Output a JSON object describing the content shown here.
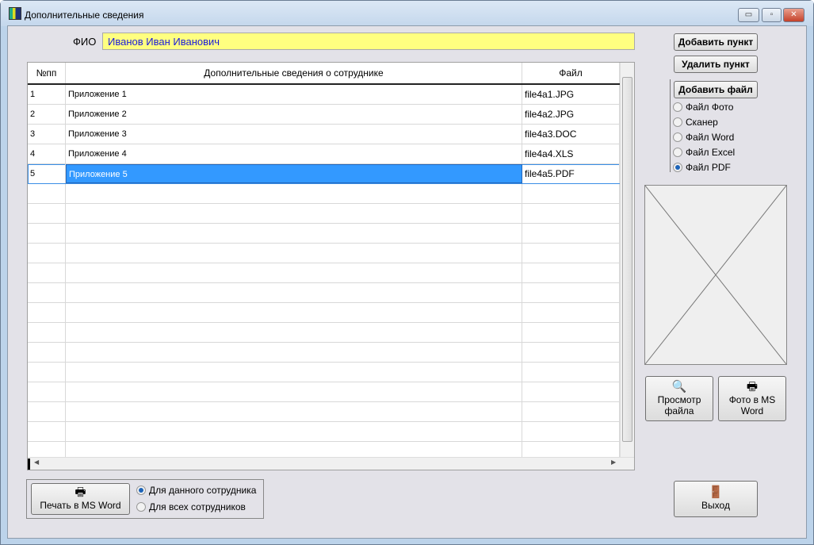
{
  "window": {
    "title": "Дополнительные сведения",
    "minimize": "▭",
    "maximize": "▫",
    "close": "✕"
  },
  "fio": {
    "label": "ФИО",
    "value": "Иванов Иван Иванович"
  },
  "grid": {
    "columns": [
      "№пп",
      "Дополнительные сведения о сотруднике",
      "Файл"
    ],
    "rows": [
      {
        "n": "1",
        "info": "Приложение 1",
        "file": "file4a1.JPG"
      },
      {
        "n": "2",
        "info": "Приложение 2",
        "file": "file4a2.JPG"
      },
      {
        "n": "3",
        "info": "Приложение 3",
        "file": "file4a3.DOC"
      },
      {
        "n": "4",
        "info": "Приложение 4",
        "file": "file4a4.XLS"
      },
      {
        "n": "5",
        "info": "Приложение 5",
        "file": "file4a5.PDF"
      }
    ],
    "selected_row": 5
  },
  "buttons": {
    "add_item": "Добавить пункт",
    "delete_item": "Удалить пункт",
    "add_file": "Добавить файл",
    "view_file": "Просмотр файла",
    "photo_word": "Фото в MS Word",
    "print_word": "Печать в MS Word",
    "exit": "Выход"
  },
  "file_types": [
    {
      "label": "Файл Фото",
      "checked": false
    },
    {
      "label": "Сканер",
      "checked": false
    },
    {
      "label": "Файл Word",
      "checked": false
    },
    {
      "label": "Файл Excel",
      "checked": false
    },
    {
      "label": "Файл PDF",
      "checked": true
    }
  ],
  "print_scope": [
    {
      "label": "Для данного сотрудника",
      "checked": true
    },
    {
      "label": "Для всех сотрудников",
      "checked": false
    }
  ]
}
